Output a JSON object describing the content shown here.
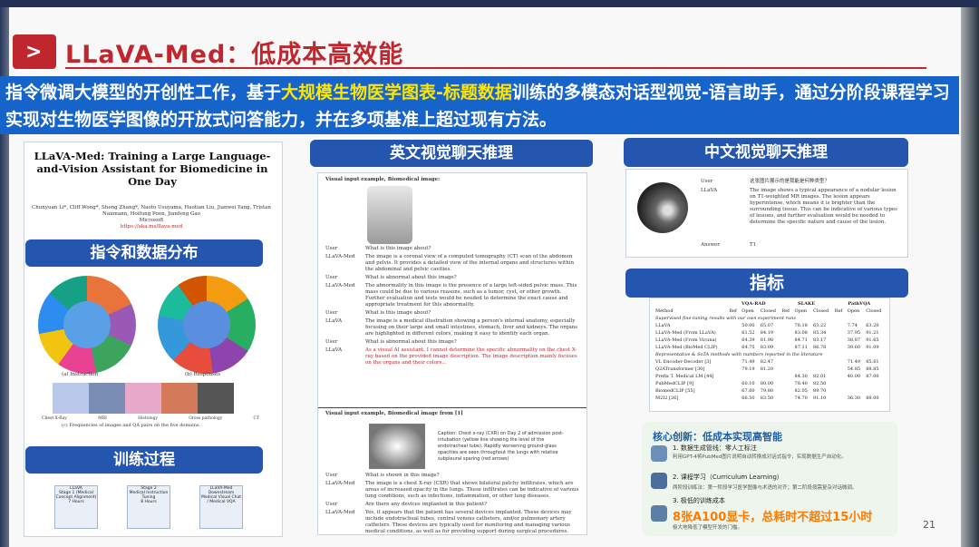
{
  "slide": {
    "title": "LLaVA-Med：低成本高效能",
    "banner_pre": "指令微调大模型的开创性工作，基于",
    "banner_highlight": "大规模生物医学图表-标题数据",
    "banner_post": "训练的多模态对话型视觉-语言助手，通过分阶段课程学习实现对生物医学图像的开放式问答能力，并在多项基准上超过现有方法。",
    "page_number": "21"
  },
  "paper": {
    "title": "LLaVA-Med: Training a Large Language-and-Vision Assistant for Biomedicine in One Day",
    "authors": "Chunyuan Li*, Cliff Wong*, Sheng Zhang*, Naoto Usuyama, Haotian Liu, Jianwei Yang, Tristan Naumann, Hoifung Poon, Jianfeng Gao",
    "affiliation": "Microsoft",
    "url": "https://aka.ms/llava-med"
  },
  "sections": {
    "data_dist": "指令和数据分布",
    "training": "训练过程",
    "english_chat": "英文视觉聊天推理",
    "chinese_chat": "中文视觉聊天推理",
    "metrics": "指标"
  },
  "data_dist": {
    "caption_a": "(a) Instruction",
    "caption_b": "(b) Responses",
    "bar_caption": "(c) Frequencies of images and QA pairs on the five domains.",
    "inner_a": [
      "type",
      "describe",
      "appearance",
      "effect"
    ],
    "inner_b": [
      "tissue",
      "lesion",
      "show",
      "cell"
    ],
    "domains": [
      "Chest X-Ray",
      "MRI",
      "Histology",
      "Gross pathology",
      "CT"
    ]
  },
  "training": {
    "stages": [
      {
        "name": "LLaVA",
        "label": "Stage 1 (Medical Concept Alignment)",
        "info": "7 Hours"
      },
      {
        "name": "Stage 2",
        "label": "Medical Instruction Tuning",
        "info": "8 Hours"
      },
      {
        "name": "LLaVA-Med",
        "label": "Downstream",
        "info": "Medical Visual Chat / Medical VQA"
      }
    ]
  },
  "english_chat": {
    "example1_header": "Visual input example, Biomedical image:",
    "lines": [
      {
        "who": "User",
        "text": "What is this image about?"
      },
      {
        "who": "LLaVA-Med",
        "text": "The image is a coronal view of a computed tomography (CT) scan of the abdomen and pelvis. It provides a detailed view of the internal organs and structures within the abdominal and pelvic cavities."
      },
      {
        "who": "User",
        "text": "What is abnormal about this image?"
      },
      {
        "who": "LLaVA-Med",
        "text": "The abnormality in this image is the presence of a large left-sided pelvic mass. This mass could be due to various reasons, such as a tumor, cyst, or other growth. Further evaluation and tests would be needed to determine the exact cause and appropriate treatment for this abnormality."
      },
      {
        "who": "User",
        "text": "What is this image about?"
      },
      {
        "who": "LLaVA",
        "text": "The image is a medical illustration showing a person's internal anatomy, especially focusing on their large and small intestines, stomach, liver and kidneys. The organs are highlighted in different colors, making it easy to identify each organ."
      },
      {
        "who": "User",
        "text": "What is abnormal about this image?"
      },
      {
        "who": "LLaVA",
        "text": "As a visual AI assistant, I cannot determine the specific abnormality on the chest X-ray based on the provided image description. The image description mainly focuses on the organs and their colors..."
      }
    ],
    "example2_header": "Visual input example, Biomedical image from [1]",
    "caption2": "Caption: Chest x-ray (CXR) on Day 2 of admission post-intubation (yellow line showing the level of the endotracheal tube). Rapidly worsening ground-glass opacities are seen throughout the lungs with relative subpleural sparing (red arrows)",
    "lines2": [
      {
        "who": "User",
        "text": "What is shown in this image?"
      },
      {
        "who": "LLaVA-Med",
        "text": "The image is a chest X-ray (CXR) that shows bilateral patchy infiltrates, which are areas of increased opacity in the lungs. These infiltrates can be indicative of various lung conditions, such as infections, inflammation, or other lung diseases."
      },
      {
        "who": "User",
        "text": "Are there any devices implanted in this patient?"
      },
      {
        "who": "LLaVA-Med",
        "text": "Yes, it appears that the patient has several devices implanted. These devices may include endotracheal tubes, central venous catheters, and/or pulmonary artery catheters. These devices are typically used for monitoring and managing various medical conditions, as well as for providing support during surgical procedures."
      }
    ]
  },
  "chinese_chat": {
    "user_label": "User",
    "question": "这张图片展示的是我能是何种类型？",
    "model_label": "LLaVA",
    "answer": "The image shows a typical appearance of a nodular lesion on T1-weighted MR images. The lesion appears hyperintense, which means it is brighter than the surrounding tissue. This can be indicative of various types of lesions, and further evaluation would be needed to determine the specific nature and cause of the lesion.",
    "answer_label": "Answer",
    "answer_value": "T1"
  },
  "metrics": {
    "groups": [
      "VQA-RAD",
      "SLAKE",
      "PathVQA"
    ],
    "subcols": [
      "Method",
      "Ref",
      "Open",
      "Closed",
      "Ref",
      "Open",
      "Closed",
      "Ref",
      "Open",
      "Closed"
    ],
    "note1": "Supervised fine-tuning results with our own experiment runs",
    "rows1": [
      [
        "LLaVA",
        "",
        "50.00",
        "65.07",
        "",
        "78.18",
        "63.22",
        "",
        "7.74",
        "63.20"
      ],
      [
        "LLaVA-Med (From LLaVA)",
        "",
        "61.52",
        "84.19",
        "",
        "83.08",
        "85.34",
        "",
        "37.95",
        "91.21"
      ],
      [
        "LLaVA-Med (From Vicuna)",
        "",
        "64.39",
        "81.98",
        "",
        "84.71",
        "83.17",
        "",
        "38.87",
        "91.65"
      ],
      [
        "LLaVA-Med (BioMed CLIP)",
        "",
        "64.75",
        "83.09",
        "",
        "87.11",
        "86.78",
        "",
        "39.60",
        "91.09"
      ]
    ],
    "note2": "Representative & SoTA methods with numbers reported in the literature",
    "rows2": [
      [
        "VL Encoder-Decoder [3]",
        "",
        "71.49",
        "82.47",
        "",
        "",
        "",
        "",
        "71.49",
        "85.61"
      ],
      [
        "Q2ATransformer [30]",
        "",
        "79.19",
        "81.20",
        "",
        "",
        "",
        "",
        "54.85",
        "88.85"
      ],
      [
        "Prefix T. Medical LM [44]",
        "",
        "",
        "",
        "",
        "84.30",
        "82.01",
        "",
        "40.00",
        "87.00"
      ],
      [
        "PubMedCLIP [9]",
        "",
        "60.10",
        "80.00",
        "",
        "78.40",
        "82.50",
        "",
        "",
        ""
      ],
      [
        "BiomedCLIP [55]",
        "",
        "67.60",
        "79.80",
        "",
        "82.05",
        "89.70",
        "",
        "",
        ""
      ],
      [
        "M2I2 [26]",
        "",
        "66.50",
        "83.50",
        "",
        "74.70",
        "91.10",
        "",
        "36.30",
        "88.00"
      ]
    ]
  },
  "innovation": {
    "title": "核心创新：低成本实现高智能",
    "item1": "1. 数据生成管线：零人工标注",
    "item1_sub": "利用GPT-4将PubMed图片说明自动转换成对话式指令，实现数据生产自动化。",
    "item2": "2. 课程学习（Curriculum Learning）",
    "item2_sub": "两阶段训练法：第一阶段学习医学图像与术语的对齐；第二阶段按需复杂对话微调。",
    "item3": "3. 极低的训练成本",
    "big": "8张A100显卡，总耗时不超过15小时",
    "item3_sub": "极大地降低了模型开发的门槛。"
  }
}
